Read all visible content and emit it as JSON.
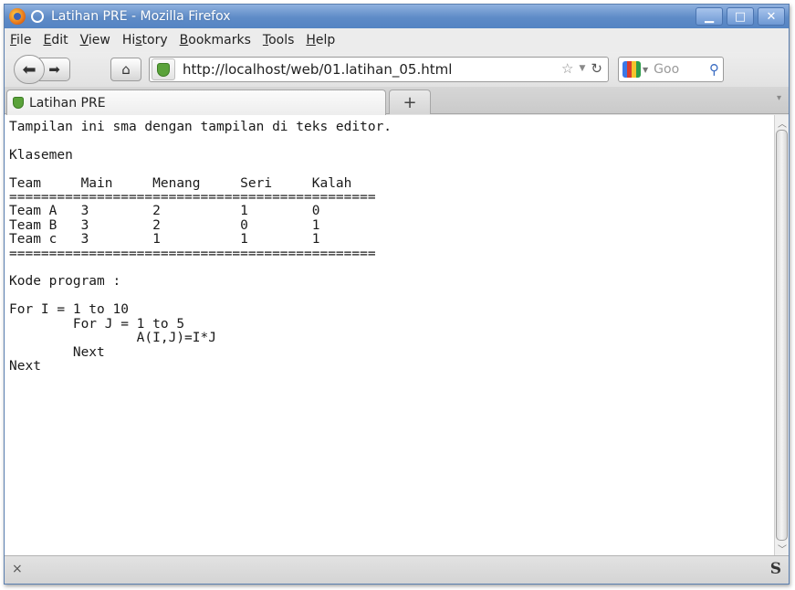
{
  "window": {
    "title": "Latihan PRE - Mozilla Firefox",
    "controls": [
      "minimize",
      "maximize",
      "close"
    ]
  },
  "menubar": [
    {
      "prefix": "",
      "key": "F",
      "rest": "ile"
    },
    {
      "prefix": "",
      "key": "E",
      "rest": "dit"
    },
    {
      "prefix": "",
      "key": "V",
      "rest": "iew"
    },
    {
      "prefix": "Hi",
      "key": "s",
      "rest": "tory"
    },
    {
      "prefix": "",
      "key": "B",
      "rest": "ookmarks"
    },
    {
      "prefix": "",
      "key": "T",
      "rest": "ools"
    },
    {
      "prefix": "",
      "key": "H",
      "rest": "elp"
    }
  ],
  "navbar": {
    "url": "http://localhost/web/01.latihan_05.html",
    "search_placeholder": "Goo"
  },
  "tabs": [
    {
      "title": "Latihan PRE",
      "active": true
    }
  ],
  "content": {
    "pre_text": "Tampilan ini sma dengan tampilan di teks editor.\n\nKlasemen\n\nTeam     Main     Menang     Seri     Kalah\n==============================================\nTeam A   3        2          1        0\nTeam B   3        2          0        1\nTeam c   3        1          1        1\n==============================================\n\nKode program :\n\nFor I = 1 to 10\n        For J = 1 to 5\n                A(I,J)=I*J\n        Next\nNext"
  },
  "statusbar": {
    "close_glyph": "×",
    "addon_glyph": "S"
  },
  "icons": {
    "back": "back-arrow-icon",
    "forward": "forward-arrow-icon",
    "home": "home-icon",
    "bookmark_star": "star-icon",
    "reload": "reload-icon",
    "search": "magnifier-icon"
  }
}
